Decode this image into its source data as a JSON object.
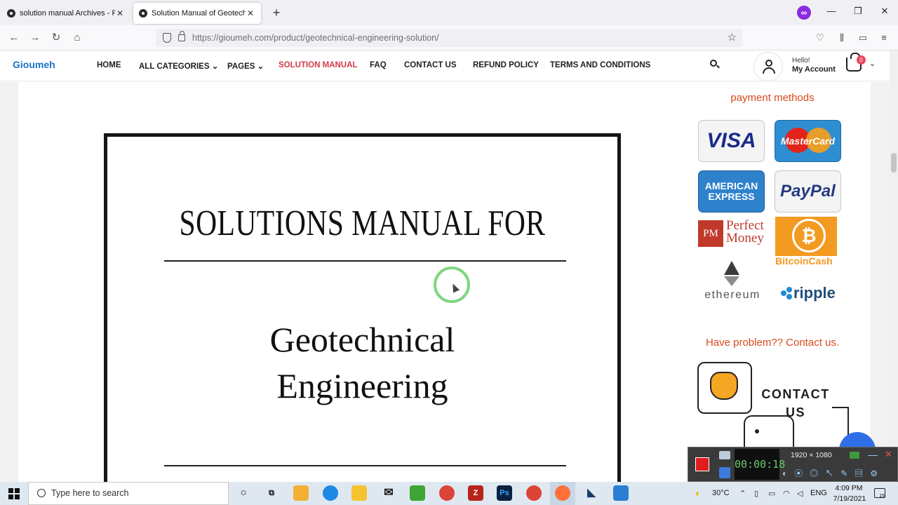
{
  "browser": {
    "tabs": [
      {
        "title": "solution manual Archives - Page",
        "active": false
      },
      {
        "title": "Solution Manual of Geotechnic",
        "active": true
      }
    ],
    "new_tab": "+",
    "url": "https://gioumeh.com/product/geotechnical-engineering-solution/",
    "window_controls": {
      "minimize": "—",
      "maximize": "❐",
      "close": "✕"
    },
    "ext_icon": "∞"
  },
  "site": {
    "logo": "Gioumeh",
    "menu": [
      {
        "label": "HOME",
        "active": false
      },
      {
        "label": "ALL CATEGORIES ⌄",
        "active": false
      },
      {
        "label": "PAGES ⌄",
        "active": false
      },
      {
        "label": "SOLUTION MANUAL",
        "active": true
      },
      {
        "label": "FAQ",
        "active": false
      },
      {
        "label": "CONTACT US",
        "active": false
      },
      {
        "label": "REFUND POLICY",
        "active": false
      },
      {
        "label": "TERMS AND CONDITIONS",
        "active": false
      }
    ],
    "account": {
      "greeting": "Hello!",
      "label": "My Account"
    },
    "cart_count": "0",
    "accent_color": "#d23a4a"
  },
  "book": {
    "title": "SOLUTIONS MANUAL FOR",
    "subject_line1": "Geotechnical",
    "subject_line2": "Engineering"
  },
  "sidebar": {
    "payment_title": "payment methods",
    "payments": {
      "visa": "VISA",
      "mastercard": "MasterCard",
      "amex_line1": "AMERICAN",
      "amex_line2": "EXPRESS",
      "paypal": "PayPal",
      "pm_logo": "PM",
      "pm_line1": "Perfect",
      "pm_line2": "Money",
      "btc_symbol": "₿",
      "btc_text": "BitcoinCash",
      "eth_text": "ethereum",
      "ripple_text": "ripple"
    },
    "contact_title": "Have problem?? Contact us.",
    "contact_line1": "CONTACT",
    "contact_line2": "US"
  },
  "recorder": {
    "timer": "00:00:18",
    "resolution": "1920 × 1080"
  },
  "taskbar": {
    "search_placeholder": "Type here to search",
    "apps": [
      "cortana",
      "task-view",
      "store",
      "edge",
      "file-explorer",
      "mail",
      "camtasia",
      "chrome",
      "filezilla",
      "photoshop",
      "chrome-alt",
      "firefox",
      "app-blue",
      "photos"
    ],
    "weather": "30°C",
    "language": "ENG",
    "time": "4:09 PM",
    "date": "7/19/2021",
    "notification_count": "15"
  }
}
